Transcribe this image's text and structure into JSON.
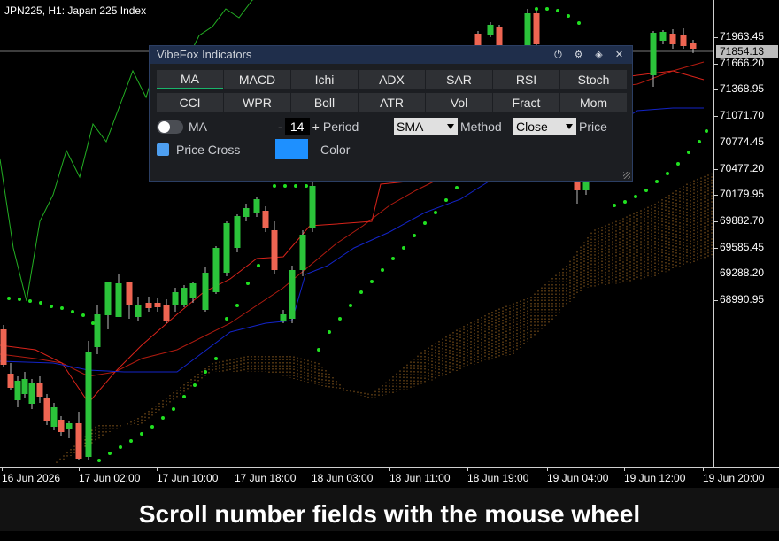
{
  "chart": {
    "title": "JPN225, H1:  Japan 225 Index",
    "current_price": "71854.13",
    "price_labels": [
      "71963.45",
      "71666.20",
      "71368.95",
      "71071.70",
      "70774.45",
      "70477.20",
      "70179.95",
      "69882.70",
      "69585.45",
      "69288.20",
      "68990.95"
    ],
    "time_labels": [
      "16 Jun 2026",
      "17 Jun 02:00",
      "17 Jun 10:00",
      "17 Jun 18:00",
      "18 Jun 03:00",
      "18 Jun 11:00",
      "18 Jun 19:00",
      "19 Jun 04:00",
      "19 Jun 12:00",
      "19 Jun 20:00"
    ],
    "colors": {
      "bull": "#2bc33a",
      "bear": "#ee6552",
      "psar": "#21e021",
      "chikou": "#23b023",
      "kijun": "#b11b10",
      "tenkan": "#d8231a",
      "senkou": "#1324c8",
      "cloud": "#b97a2a"
    }
  },
  "panel": {
    "title": "VibeFox Indicators",
    "header_icons": [
      "power-icon",
      "gear-icon",
      "diamond-icon",
      "close-icon"
    ],
    "tabs": [
      [
        "MA",
        "MACD",
        "Ichi",
        "ADX",
        "SAR",
        "RSI",
        "Stoch"
      ],
      [
        "CCI",
        "WPR",
        "Boll",
        "ATR",
        "Vol",
        "Fract",
        "Mom"
      ]
    ],
    "active_tab": "MA",
    "ma_label": "MA",
    "period_minus": "-",
    "period_value": "14",
    "period_plus": "+",
    "period_label": "Period",
    "method_value": "SMA",
    "method_label": "Method",
    "price_value": "Close",
    "price_label": "Price",
    "price_cross_label": "Price Cross",
    "color_label": "Color",
    "swatch_color": "#1e90ff"
  },
  "caption": "Scroll number fields with the mouse wheel"
}
